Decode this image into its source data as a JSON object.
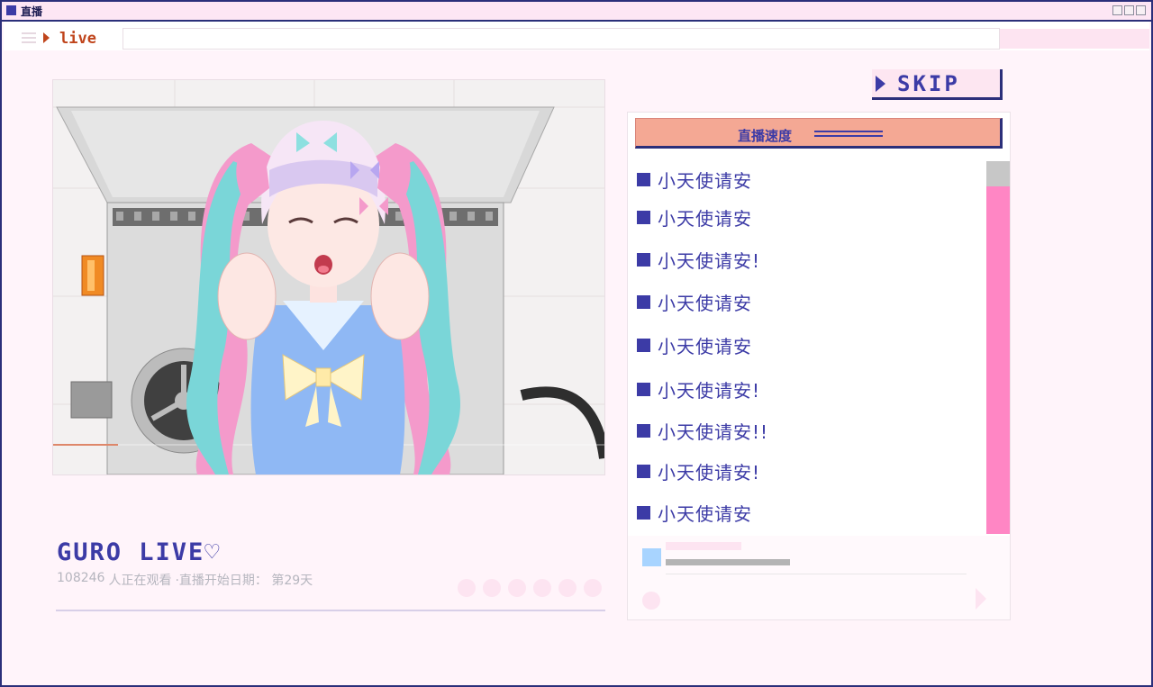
{
  "window": {
    "title": "直播"
  },
  "nav": {
    "live_label": "live"
  },
  "skip": {
    "label": "SKIP"
  },
  "stream": {
    "title": "GURO LIVE♡",
    "viewers": "108246",
    "viewers_suffix": "人正在观看",
    "start_info": "·直播开始日期： 第29天"
  },
  "chat": {
    "header": "直播速度",
    "messages": [
      "小天使请安",
      "小天使请安",
      "小天使请安!",
      "小天使请安",
      "小天使请安",
      "小天使请安!",
      "小天使请安!!",
      "小天使请安!",
      "小天使请安"
    ]
  },
  "colors": {
    "accent": "#3c3ba6",
    "live": "#c0451c",
    "chat_header": "#f4a894",
    "scrollbar": "#ff86c4"
  },
  "icons": {
    "burger": "menu-icon",
    "play": "play-icon",
    "skip_arrow": "play-arrow-icon"
  }
}
